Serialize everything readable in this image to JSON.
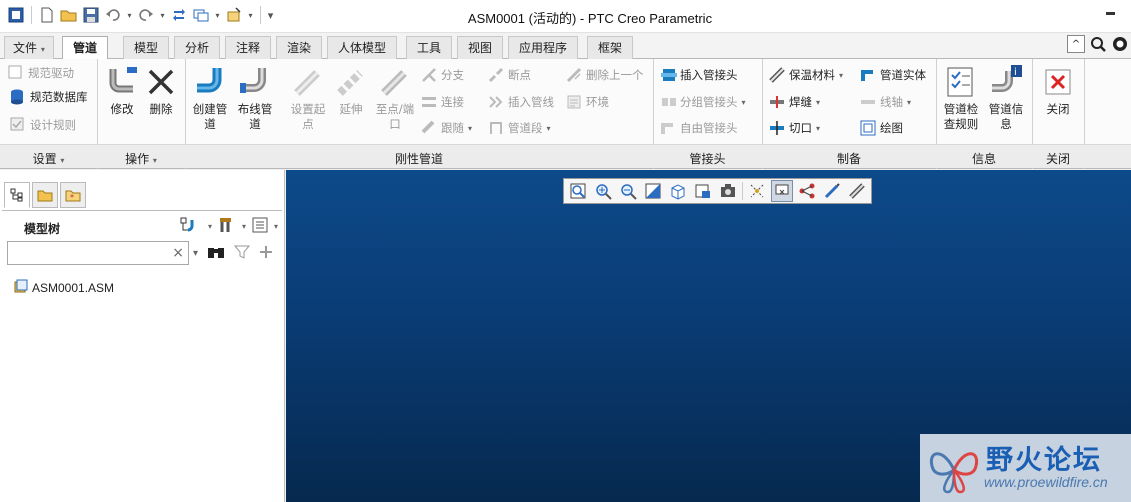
{
  "window": {
    "title": "ASM0001 (活动的) - PTC Creo Parametric"
  },
  "qat": {
    "icons": [
      "app-icon",
      "new-icon",
      "open-icon",
      "save-icon",
      "undo-icon",
      "redo-icon",
      "regenerate-icon",
      "windows-icon",
      "close-window-icon",
      "customize-icon"
    ]
  },
  "tabs": {
    "file": "文件",
    "items": [
      "管道",
      "模型",
      "分析",
      "注释",
      "渲染",
      "人体模型",
      "工具",
      "视图",
      "应用程序",
      "框架"
    ],
    "active": "管道"
  },
  "ribbon": {
    "settings": {
      "spec_driven": "规范驱动",
      "spec_db": "规范数据库",
      "design_rules": "设计规则",
      "group": "设置"
    },
    "operations": {
      "modify": "修改",
      "delete": "删除",
      "group": "操作"
    },
    "rigid_pipe": {
      "create_pipe": "创建管道",
      "route_pipe": "布线管道",
      "set_start": "设置起点",
      "extend": "延伸",
      "to_point": "至点/端口",
      "branch": "分支",
      "connect": "连接",
      "follow": "跟随",
      "break": "断点",
      "insert_pipeline": "插入管线",
      "pipe_segment": "管道段",
      "delete_prev": "删除上一个",
      "environment": "环境",
      "group": "刚性管道"
    },
    "fittings": {
      "insert_fitting": "插入管接头",
      "group_fitting": "分组管接头",
      "free_fitting": "自由管接头",
      "group": "管接头"
    },
    "fabrication": {
      "insulation": "保温材料",
      "weld": "焊缝",
      "cut": "切口",
      "pipe_solid": "管道实体",
      "centerline": "线轴",
      "drawing": "绘图",
      "group": "制备"
    },
    "info": {
      "check_rules": "管道检查规则",
      "pipe_info": "管道信息",
      "group": "信息"
    },
    "close": {
      "close": "关闭",
      "group": "关闭"
    }
  },
  "left_panel": {
    "title": "模型树",
    "search_placeholder": "",
    "tree": [
      {
        "label": "ASM0001.ASM"
      }
    ]
  },
  "watermark": {
    "title": "野火论坛",
    "url": "www.proewildfire.cn"
  },
  "colors": {
    "viewport_top": "#0d4a8a",
    "viewport_bottom": "#06294f",
    "accent": "#1a5fb4"
  }
}
